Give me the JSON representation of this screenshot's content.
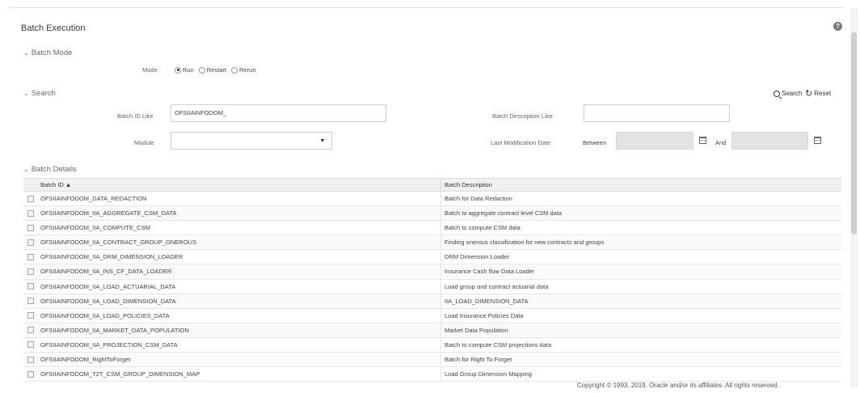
{
  "page": {
    "title": "Batch Execution",
    "help_icon": "help-circle-icon",
    "footer": "Copyright © 1993, 2019, Oracle and/or its affiliates. All rights reserved."
  },
  "batch_mode": {
    "section_label": "Batch Mode",
    "mode_label": "Mode",
    "options": [
      {
        "label": "Run",
        "selected": true
      },
      {
        "label": "Restart",
        "selected": false
      },
      {
        "label": "Rerun",
        "selected": false
      }
    ]
  },
  "search": {
    "section_label": "Search",
    "search_label": "Search",
    "reset_label": "Reset",
    "batch_id_label": "Batch ID Like",
    "batch_id_value": "OFSIIAINFODOM_",
    "batch_desc_label": "Batch Description Like",
    "batch_desc_value": "",
    "module_label": "Module",
    "module_value": "",
    "last_mod_label": "Last Modification Date",
    "between_label": "Between",
    "and_label": "And",
    "between_value": "",
    "and_value": ""
  },
  "batch_details": {
    "section_label": "Batch Details",
    "columns": [
      "Batch ID ▲",
      "Batch Description"
    ],
    "rows": [
      {
        "id": "OFSIIAINFODOM_DATA_REDACTION",
        "desc": "Batch for Data Redaction"
      },
      {
        "id": "OFSIIAINFODOM_IIA_AGGREGATE_CSM_DATA",
        "desc": "Batch to aggregate contract level CSM data"
      },
      {
        "id": "OFSIIAINFODOM_IIA_COMPUTE_CSM",
        "desc": "Batch to compute CSM data"
      },
      {
        "id": "OFSIIAINFODOM_IIA_CONTRACT_GROUP_ONEROUS",
        "desc": "Finding onerous classification for new contracts and groups"
      },
      {
        "id": "OFSIIAINFODOM_IIA_DRM_DIMENSION_LOADER",
        "desc": "DRM Dimension Loader"
      },
      {
        "id": "OFSIIAINFODOM_IIA_INS_CF_DATA_LOADER",
        "desc": "Insurance Cash flow Data Loader"
      },
      {
        "id": "OFSIIAINFODOM_IIA_LOAD_ACTUARIAL_DATA",
        "desc": "Load group and contract actuarial data"
      },
      {
        "id": "OFSIIAINFODOM_IIA_LOAD_DIMENSION_DATA",
        "desc": "IIA_LOAD_DIMENSION_DATA"
      },
      {
        "id": "OFSIIAINFODOM_IIA_LOAD_POLICIES_DATA",
        "desc": "Load Insurance Policies Data"
      },
      {
        "id": "OFSIIAINFODOM_IIA_MARKET_DATA_POPULATION",
        "desc": "Market Data Population"
      },
      {
        "id": "OFSIIAINFODOM_IIA_PROJECTION_CSM_DATA",
        "desc": "Batch to compute CSM projections data"
      },
      {
        "id": "OFSIIAINFODOM_RightToForget",
        "desc": "Batch for Right To Forget"
      },
      {
        "id": "OFSIIAINFODOM_T2T_CSM_GROUP_DIMENSION_MAP",
        "desc": "Load Group Dimension Mapping"
      }
    ]
  }
}
